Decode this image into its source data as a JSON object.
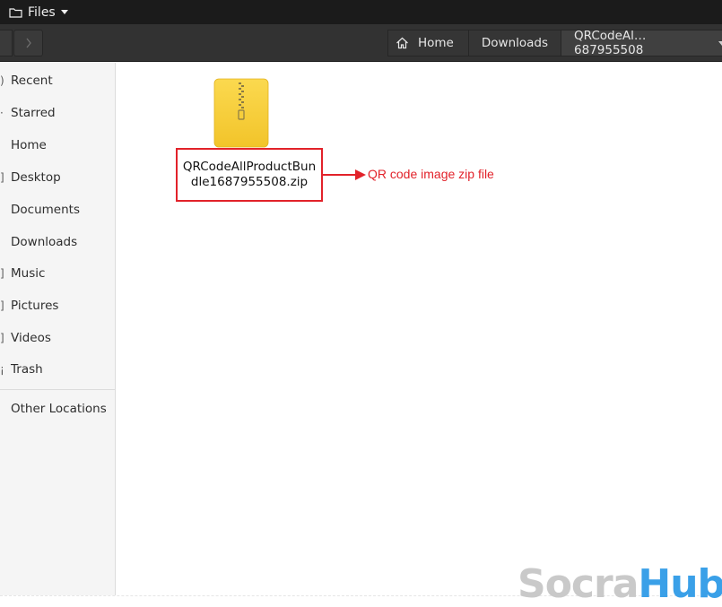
{
  "window": {
    "app_menu_label": "Files"
  },
  "pathbar": {
    "home_label": "Home",
    "downloads_label": "Downloads",
    "current_label": "QRCodeAl…687955508"
  },
  "sidebar": {
    "items": [
      {
        "label": "Recent",
        "icon": "clock-icon",
        "glyph": ")"
      },
      {
        "label": "Starred",
        "icon": "star-icon",
        "glyph": "·"
      },
      {
        "label": "Home",
        "icon": "home-icon",
        "glyph": ""
      },
      {
        "label": "Desktop",
        "icon": "desktop-icon",
        "glyph": "]"
      },
      {
        "label": "Documents",
        "icon": "documents-icon",
        "glyph": ""
      },
      {
        "label": "Downloads",
        "icon": "downloads-icon",
        "glyph": ""
      },
      {
        "label": "Music",
        "icon": "music-icon",
        "glyph": "]"
      },
      {
        "label": "Pictures",
        "icon": "pictures-icon",
        "glyph": "]"
      },
      {
        "label": "Videos",
        "icon": "videos-icon",
        "glyph": "]"
      },
      {
        "label": "Trash",
        "icon": "trash-icon",
        "glyph": "¡"
      }
    ],
    "other": {
      "label": "Other Locations",
      "icon": "plus-icon",
      "glyph": ""
    }
  },
  "content": {
    "file": {
      "name": "QRCodeAllProductBundle1687955508.zip",
      "icon": "zip-archive-icon"
    },
    "annotation": "QR code image zip file"
  },
  "watermark": {
    "part1": "Socra",
    "part2": "Hub"
  },
  "colors": {
    "annotation": "#e2222a",
    "watermark_gray": "#c9c9c9",
    "watermark_blue": "#3aa0e8",
    "zip_yellow": "#f7cc35"
  }
}
